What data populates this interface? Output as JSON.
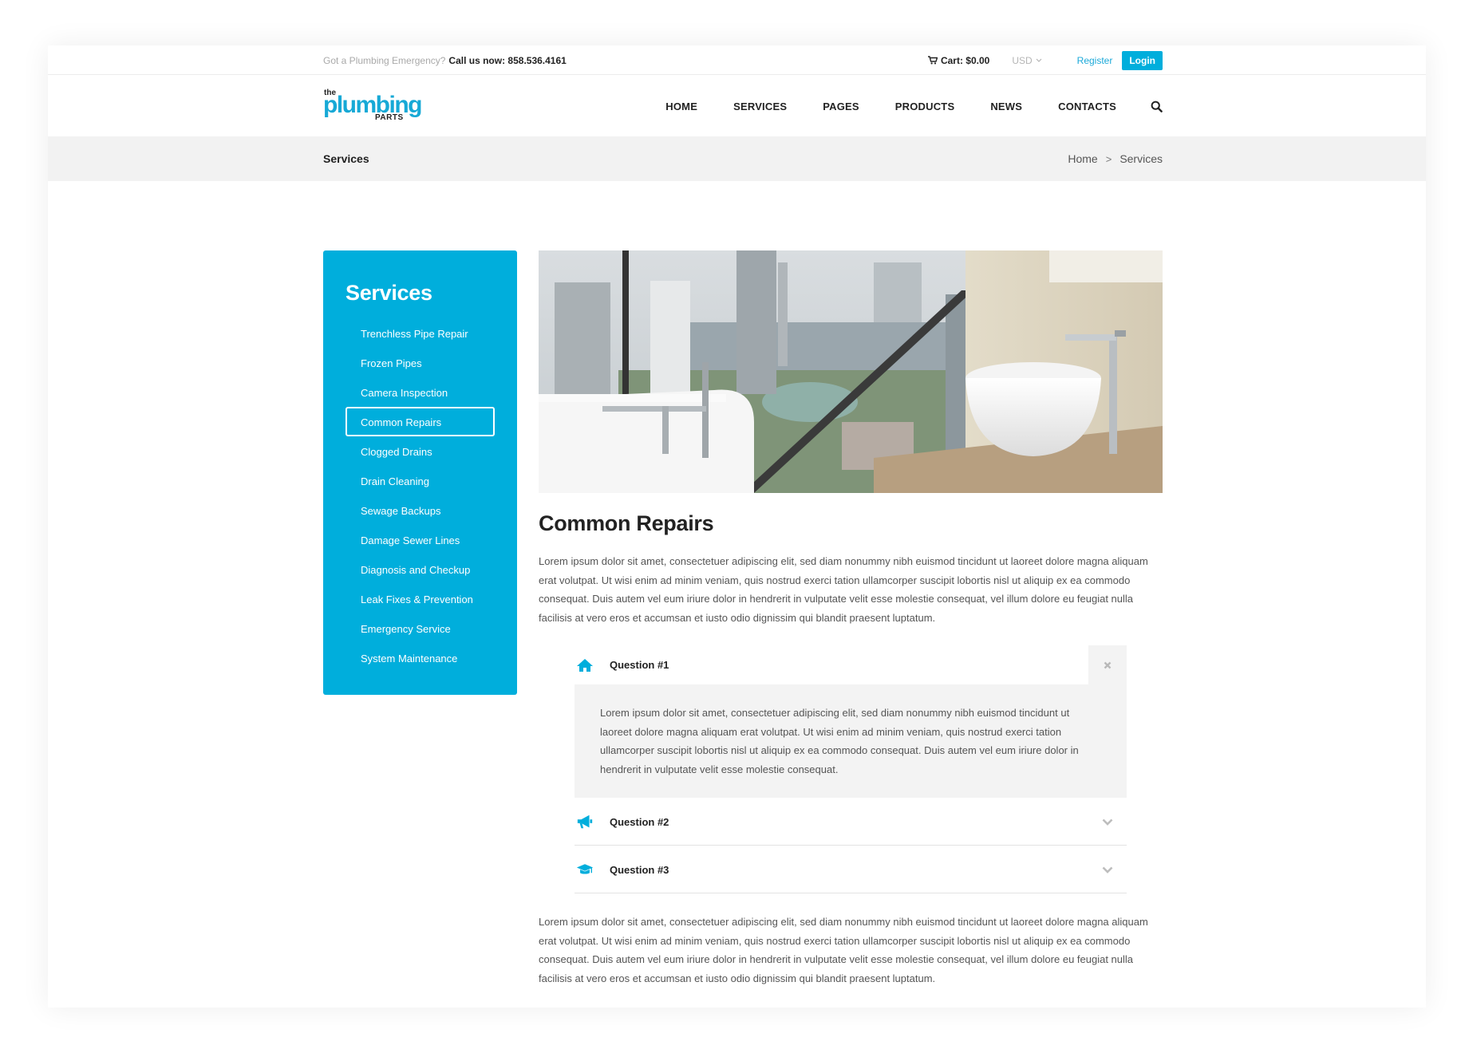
{
  "topbar": {
    "emergency_prefix": "Got a Plumbing Emergency?",
    "emergency_call": "Call us now: 858.536.4161",
    "cart": "Cart: $0.00",
    "currency": "USD",
    "register": "Register",
    "login": "Login"
  },
  "logo": {
    "the": "the",
    "main": "plumbing",
    "parts": "PARTS"
  },
  "nav": {
    "items": [
      "HOME",
      "SERVICES",
      "PAGES",
      "PRODUCTS",
      "NEWS",
      "CONTACTS"
    ]
  },
  "breadcrumb": {
    "title": "Services",
    "home": "Home",
    "separator": ">",
    "current": "Services"
  },
  "sidebar": {
    "title": "Services",
    "items": [
      "Trenchless Pipe Repair",
      "Frozen Pipes",
      "Camera Inspection",
      "Common Repairs",
      "Clogged Drains",
      "Drain Cleaning",
      "Sewage Backups",
      "Damage Sewer Lines",
      "Diagnosis and Checkup",
      "Leak Fixes & Prevention",
      "Emergency Service",
      "System Maintenance"
    ],
    "active_index": 3
  },
  "main": {
    "title": "Common Repairs",
    "intro": "Lorem ipsum dolor sit amet, consectetuer adipiscing elit, sed diam nonummy nibh euismod tincidunt ut laoreet dolore magna aliquam erat volutpat. Ut wisi enim ad minim veniam, quis nostrud exerci tation ullamcorper suscipit lobortis nisl ut aliquip ex ea commodo consequat. Duis autem vel eum iriure dolor in hendrerit in vulputate velit esse molestie consequat, vel illum dolore eu feugiat nulla facilisis at vero eros et accumsan et iusto odio dignissim qui blandit praesent luptatum.",
    "outro": "Lorem ipsum dolor sit amet, consectetuer adipiscing elit, sed diam nonummy nibh euismod tincidunt ut laoreet dolore magna aliquam erat volutpat. Ut wisi enim ad minim veniam, quis nostrud exerci tation ullamcorper suscipit lobortis nisl ut aliquip ex ea commodo consequat. Duis autem vel eum iriure dolor in hendrerit in vulputate velit esse molestie consequat, vel illum dolore eu feugiat nulla facilisis at vero eros et accumsan et iusto odio dignissim qui blandit praesent luptatum."
  },
  "accordion": [
    {
      "label": "Question #1",
      "icon": "home-icon",
      "open": true,
      "body": "Lorem ipsum dolor sit amet, consectetuer adipiscing elit, sed diam nonummy nibh euismod tincidunt ut laoreet dolore magna aliquam erat volutpat. Ut wisi enim ad minim veniam, quis nostrud exerci tation ullamcorper suscipit lobortis nisl ut aliquip ex ea commodo consequat. Duis autem vel eum iriure dolor in hendrerit in vulputate velit esse molestie consequat."
    },
    {
      "label": "Question #2",
      "icon": "megaphone-icon",
      "open": false
    },
    {
      "label": "Question #3",
      "icon": "graduation-cap-icon",
      "open": false
    }
  ],
  "colors": {
    "accent": "#00aedc",
    "text": "#222222",
    "muted": "#555555",
    "band": "#f2f2f2"
  }
}
